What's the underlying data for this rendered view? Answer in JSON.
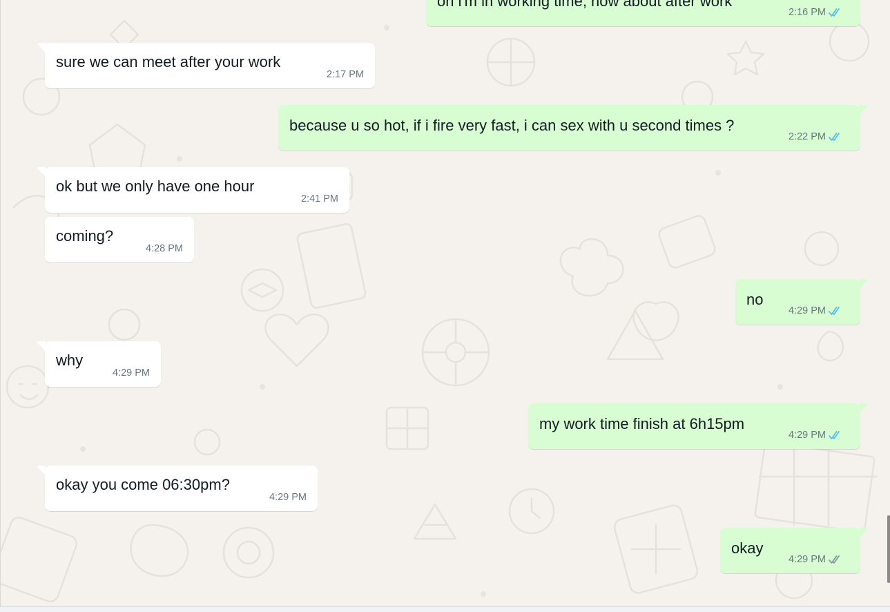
{
  "colors": {
    "incoming_bubble": "#ffffff",
    "outgoing_bubble": "#d9fdd3",
    "read_tick": "#53bdeb",
    "delivered_tick": "#8696a0",
    "background": "#f5f2ee"
  },
  "messages": [
    {
      "direction": "out",
      "text": "oh i'm in working time, how about after work",
      "time": "2:16 PM",
      "status": "read"
    },
    {
      "direction": "in",
      "text": "sure we can meet after your work",
      "time": "2:17 PM"
    },
    {
      "direction": "out",
      "text": "because u so hot, if i fire very fast, i can sex with u second times ?",
      "time": "2:22 PM",
      "status": "read"
    },
    {
      "direction": "in",
      "text": "ok but we only have one hour",
      "time": "2:41 PM"
    },
    {
      "direction": "in",
      "text": "coming?",
      "time": "4:28 PM"
    },
    {
      "direction": "out",
      "text": "no",
      "time": "4:29 PM",
      "status": "read"
    },
    {
      "direction": "in",
      "text": "why",
      "time": "4:29 PM"
    },
    {
      "direction": "out",
      "text": "my work time finish at 6h15pm",
      "time": "4:29 PM",
      "status": "read"
    },
    {
      "direction": "in",
      "text": "okay you come 06:30pm?",
      "time": "4:29 PM"
    },
    {
      "direction": "out",
      "text": "okay",
      "time": "4:29 PM",
      "status": "delivered"
    }
  ]
}
